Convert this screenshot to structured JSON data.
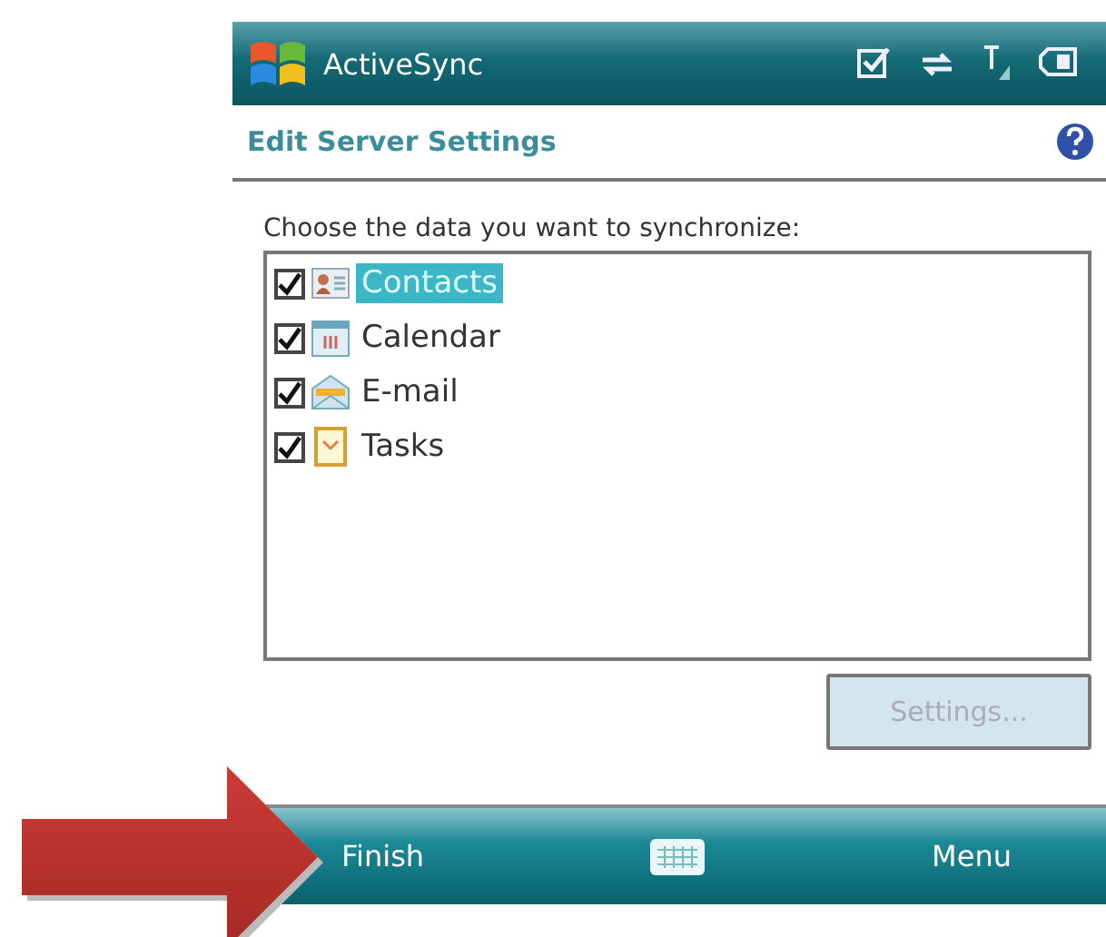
{
  "title_bar": {
    "app_name": "ActiveSync"
  },
  "header": {
    "title": "Edit Server Settings"
  },
  "prompt": "Choose the data you want to synchronize:",
  "items": [
    {
      "label": "Contacts",
      "kind": "contacts",
      "checked": true,
      "selected": true
    },
    {
      "label": "Calendar",
      "kind": "calendar",
      "checked": true,
      "selected": false
    },
    {
      "label": "E-mail",
      "kind": "email",
      "checked": true,
      "selected": false
    },
    {
      "label": "Tasks",
      "kind": "tasks",
      "checked": true,
      "selected": false
    }
  ],
  "settings_button": {
    "label": "Settings...",
    "disabled": true
  },
  "softkeys": {
    "left": "Finish",
    "right": "Menu"
  }
}
